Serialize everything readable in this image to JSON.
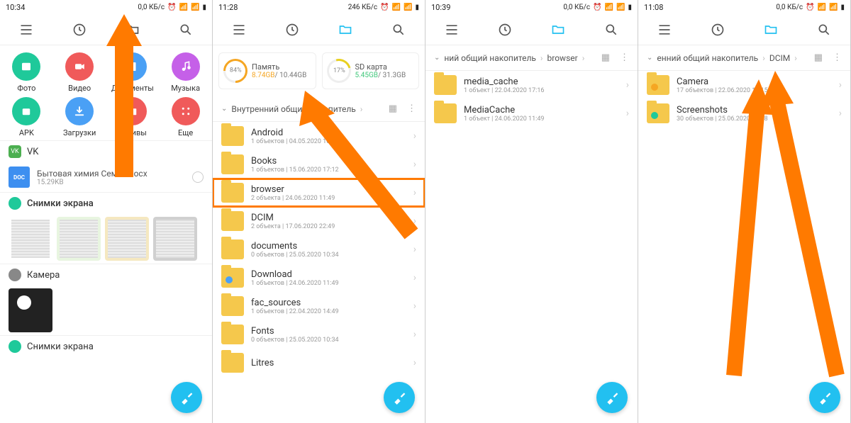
{
  "pane1": {
    "time": "10:34",
    "net": "0,0 КБ/с",
    "categories": [
      {
        "label": "Фото",
        "color": "#1fc99a",
        "icon": "image"
      },
      {
        "label": "Видео",
        "color": "#f05a5a",
        "icon": "video"
      },
      {
        "label": "Документы",
        "color": "#4aa0f5",
        "icon": "doc"
      },
      {
        "label": "Музыка",
        "color": "#c560e8",
        "icon": "music"
      },
      {
        "label": "APK",
        "color": "#1fc99a",
        "icon": "apk"
      },
      {
        "label": "Загрузки",
        "color": "#4aa0f5",
        "icon": "download"
      },
      {
        "label": "Архивы",
        "color": "#f05a5a",
        "icon": "archive"
      },
      {
        "label": "Еще",
        "color": "#f05a5a",
        "icon": "grid"
      }
    ],
    "vk_label": "VK",
    "doc_name": "Бытовая химия Семья.docx",
    "doc_size": "15.29KB",
    "screenshots_label": "Снимки экрана",
    "camera_label": "Камера",
    "screenshots_label2": "Снимки экрана"
  },
  "pane2": {
    "time": "11:28",
    "net": "246 КБ/с",
    "mem_label": "Память",
    "mem_pct": "84%",
    "mem_used": "8.74GB",
    "mem_total": "10.44GB",
    "sd_label": "SD карта",
    "sd_pct": "17%",
    "sd_used": "5.45GB",
    "sd_total": "31.3GB",
    "breadcrumb": "Внутренний общий накопитель",
    "folders": [
      {
        "name": "Android",
        "meta": "1 объектов | 04.05.2020 10:07"
      },
      {
        "name": "Books",
        "meta": "1 объектов | 15.06.2020 17:12"
      },
      {
        "name": "browser",
        "meta": "2 объекта | 24.06.2020 11:49",
        "highlight": true
      },
      {
        "name": "DCIM",
        "meta": "2 объекта | 17.06.2020 22:49"
      },
      {
        "name": "documents",
        "meta": "0 объектов | 25.05.2020 10:34"
      },
      {
        "name": "Download",
        "meta": "1 объектов | 24.06.2020 11:49",
        "badge": "#4aa0f5"
      },
      {
        "name": "fac_sources",
        "meta": "1 объектов | 22.04.2020 14:49"
      },
      {
        "name": "Fonts",
        "meta": "0 объектов | 25.05.2020 10:34"
      },
      {
        "name": "Litres",
        "meta": ""
      }
    ]
  },
  "pane3": {
    "time": "10:39",
    "net": "0,0 КБ/с",
    "breadcrumb_prefix": "ний общий накопитель",
    "breadcrumb_current": "browser",
    "folders": [
      {
        "name": "media_cache",
        "meta": "1 объект | 22.04.2020 17:16"
      },
      {
        "name": "MediaCache",
        "meta": "1 объект | 24.06.2020 11:49"
      }
    ]
  },
  "pane4": {
    "time": "11:08",
    "net": "0,0 КБ/с",
    "breadcrumb_prefix": "енний общий накопитель",
    "breadcrumb_current": "DCIM",
    "folders": [
      {
        "name": "Camera",
        "meta": "17 объектов | 22.06.2020 19:15",
        "badge": "#f5a623"
      },
      {
        "name": "Screenshots",
        "meta": "30 объектов | 25.06.2020 10:38",
        "badge": "#1fc99a"
      }
    ]
  }
}
